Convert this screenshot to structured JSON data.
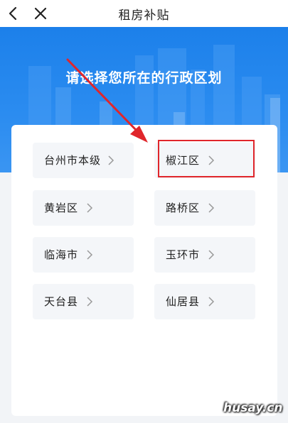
{
  "nav": {
    "title": "租房补贴",
    "back_icon": "back-arrow-icon",
    "close_icon": "close-icon"
  },
  "banner": {
    "heading": "请选择您所在的行政区划",
    "color": "#1c80ea"
  },
  "districts": [
    {
      "label": "台州市本级"
    },
    {
      "label": "椒江区"
    },
    {
      "label": "黄岩区"
    },
    {
      "label": "路桥区"
    },
    {
      "label": "临海市"
    },
    {
      "label": "玉环市"
    },
    {
      "label": "天台县"
    },
    {
      "label": "仙居县"
    }
  ],
  "annotation": {
    "highlight_color": "#e0262b",
    "highlighted_item": "椒江区"
  },
  "watermark": "husay.cn"
}
